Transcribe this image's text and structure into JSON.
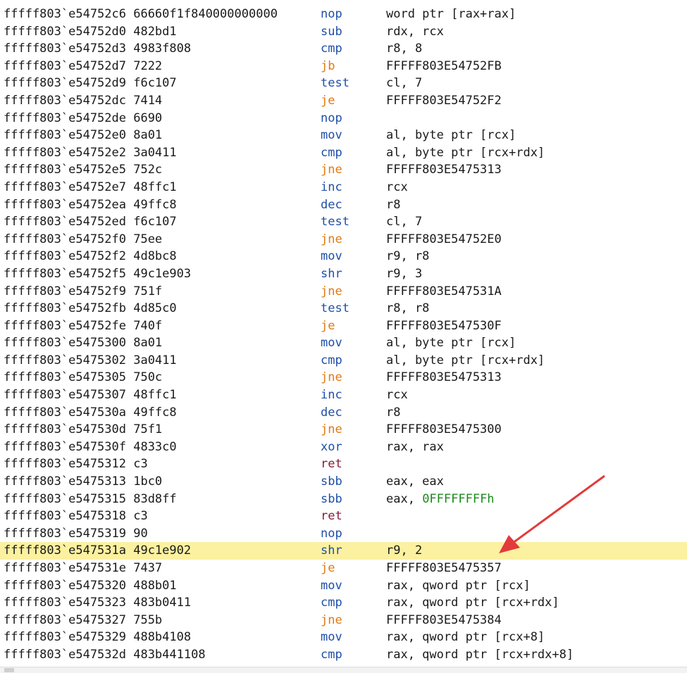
{
  "rows": [
    {
      "addr": "fffff803`e54752c6 66660f1f840000000000",
      "mn": "nop",
      "ops": "word ptr [rax+rax]",
      "cls": "normal"
    },
    {
      "addr": "fffff803`e54752d0 482bd1",
      "mn": "sub",
      "ops": "rdx, rcx",
      "cls": "normal"
    },
    {
      "addr": "fffff803`e54752d3 4983f808",
      "mn": "cmp",
      "ops": "r8, 8",
      "cls": "normal"
    },
    {
      "addr": "fffff803`e54752d7 7222",
      "mn": "jb",
      "ops": "FFFFF803E54752FB",
      "cls": "jump"
    },
    {
      "addr": "fffff803`e54752d9 f6c107",
      "mn": "test",
      "ops": "cl, 7",
      "cls": "normal"
    },
    {
      "addr": "fffff803`e54752dc 7414",
      "mn": "je",
      "ops": "FFFFF803E54752F2",
      "cls": "jump"
    },
    {
      "addr": "fffff803`e54752de 6690",
      "mn": "nop",
      "ops": "",
      "cls": "normal"
    },
    {
      "addr": "fffff803`e54752e0 8a01",
      "mn": "mov",
      "ops": "al, byte ptr [rcx]",
      "cls": "normal"
    },
    {
      "addr": "fffff803`e54752e2 3a0411",
      "mn": "cmp",
      "ops": "al, byte ptr [rcx+rdx]",
      "cls": "normal"
    },
    {
      "addr": "fffff803`e54752e5 752c",
      "mn": "jne",
      "ops": "FFFFF803E5475313",
      "cls": "jump"
    },
    {
      "addr": "fffff803`e54752e7 48ffc1",
      "mn": "inc",
      "ops": "rcx",
      "cls": "normal"
    },
    {
      "addr": "fffff803`e54752ea 49ffc8",
      "mn": "dec",
      "ops": "r8",
      "cls": "normal"
    },
    {
      "addr": "fffff803`e54752ed f6c107",
      "mn": "test",
      "ops": "cl, 7",
      "cls": "normal"
    },
    {
      "addr": "fffff803`e54752f0 75ee",
      "mn": "jne",
      "ops": "FFFFF803E54752E0",
      "cls": "jump"
    },
    {
      "addr": "fffff803`e54752f2 4d8bc8",
      "mn": "mov",
      "ops": "r9, r8",
      "cls": "normal"
    },
    {
      "addr": "fffff803`e54752f5 49c1e903",
      "mn": "shr",
      "ops": "r9, 3",
      "cls": "normal"
    },
    {
      "addr": "fffff803`e54752f9 751f",
      "mn": "jne",
      "ops": "FFFFF803E547531A",
      "cls": "jump"
    },
    {
      "addr": "fffff803`e54752fb 4d85c0",
      "mn": "test",
      "ops": "r8, r8",
      "cls": "normal"
    },
    {
      "addr": "fffff803`e54752fe 740f",
      "mn": "je",
      "ops": "FFFFF803E547530F",
      "cls": "jump"
    },
    {
      "addr": "fffff803`e5475300 8a01",
      "mn": "mov",
      "ops": "al, byte ptr [rcx]",
      "cls": "normal"
    },
    {
      "addr": "fffff803`e5475302 3a0411",
      "mn": "cmp",
      "ops": "al, byte ptr [rcx+rdx]",
      "cls": "normal"
    },
    {
      "addr": "fffff803`e5475305 750c",
      "mn": "jne",
      "ops": "FFFFF803E5475313",
      "cls": "jump"
    },
    {
      "addr": "fffff803`e5475307 48ffc1",
      "mn": "inc",
      "ops": "rcx",
      "cls": "normal"
    },
    {
      "addr": "fffff803`e547530a 49ffc8",
      "mn": "dec",
      "ops": "r8",
      "cls": "normal"
    },
    {
      "addr": "fffff803`e547530d 75f1",
      "mn": "jne",
      "ops": "FFFFF803E5475300",
      "cls": "jump"
    },
    {
      "addr": "fffff803`e547530f 4833c0",
      "mn": "xor",
      "ops": "rax, rax",
      "cls": "normal"
    },
    {
      "addr": "fffff803`e5475312 c3",
      "mn": "ret",
      "ops": "",
      "cls": "ret"
    },
    {
      "addr": "fffff803`e5475313 1bc0",
      "mn": "sbb",
      "ops": "eax, eax",
      "cls": "normal"
    },
    {
      "addr": "fffff803`e5475315 83d8ff",
      "mn": "sbb",
      "ops": "eax, ",
      "imm": "0FFFFFFFFh",
      "cls": "normal"
    },
    {
      "addr": "fffff803`e5475318 c3",
      "mn": "ret",
      "ops": "",
      "cls": "ret"
    },
    {
      "addr": "fffff803`e5475319 90",
      "mn": "nop",
      "ops": "",
      "cls": "normal"
    },
    {
      "addr": "fffff803`e547531a 49c1e902",
      "mn": "shr",
      "ops": "r9, 2",
      "cls": "normal",
      "highlighted": true
    },
    {
      "addr": "fffff803`e547531e 7437",
      "mn": "je",
      "ops": "FFFFF803E5475357",
      "cls": "jump"
    },
    {
      "addr": "fffff803`e5475320 488b01",
      "mn": "mov",
      "ops": "rax, qword ptr [rcx]",
      "cls": "normal"
    },
    {
      "addr": "fffff803`e5475323 483b0411",
      "mn": "cmp",
      "ops": "rax, qword ptr [rcx+rdx]",
      "cls": "normal"
    },
    {
      "addr": "fffff803`e5475327 755b",
      "mn": "jne",
      "ops": "FFFFF803E5475384",
      "cls": "jump"
    },
    {
      "addr": "fffff803`e5475329 488b4108",
      "mn": "mov",
      "ops": "rax, qword ptr [rcx+8]",
      "cls": "normal"
    },
    {
      "addr": "fffff803`e547532d 483b441108",
      "mn": "cmp",
      "ops": "rax, qword ptr [rcx+rdx+8]",
      "cls": "normal"
    }
  ],
  "colors": {
    "mnemonic": "#1f4fa8",
    "jump": "#e07a10",
    "ret": "#8b1a3a",
    "immediate": "#1b8a1b",
    "highlight": "#fbf1a0",
    "arrow": "#e23b3b"
  },
  "annotation": {
    "icon": "red-arrow-icon",
    "points_to_row": 31
  }
}
